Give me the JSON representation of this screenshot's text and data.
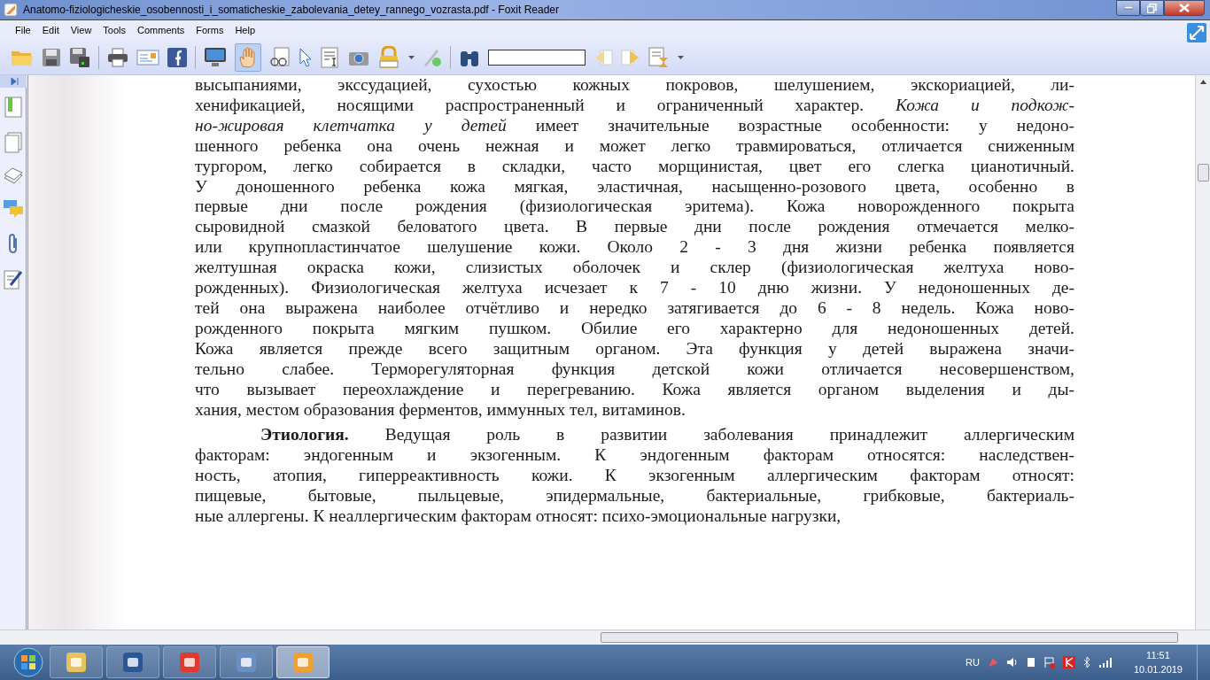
{
  "window": {
    "title": "Anatomo-fiziologicheskie_osobennosti_i_somaticheskie_zabolevania_detey_rannego_vozrasta.pdf - Foxit Reader"
  },
  "menu": [
    "File",
    "Edit",
    "View",
    "Tools",
    "Comments",
    "Forms",
    "Help"
  ],
  "toolbar": {
    "hand_tool": {
      "selected": true
    }
  },
  "document": {
    "paragraphs": [
      {
        "indented": false,
        "lines": [
          "высыпаниями, экссудацией, сухостью кожных покровов, шелушением, экскориацией, ли-",
          "хенификацией, носящими распространенный и ограниченный характер. *Кожа и подкож-*",
          "*но-жировая клетчатка у детей* имеет значительные возрастные особенности: у недоно-",
          "шенного ребенка она очень нежная и может легко травмироваться, отличается сниженным",
          "тургором, легко собирается в складки, часто морщинистая, цвет его слегка цианотичный.",
          "У доношенного ребенка кожа мягкая, эластичная, насыщенно-розового цвета, особенно в",
          "первые дни после рождения (физиологическая эритема). Кожа новорожденного покрыта",
          "сыровидной смазкой беловатого цвета. В первые дни после рождения отмечается мелко-",
          "или крупнопластинчатое шелушение кожи. Около 2 - 3 дня жизни ребенка появляется",
          "желтушная окраска кожи, слизистых оболочек и склер (физиологическая желтуха ново-",
          "рожденных). Физиологическая желтуха исчезает к 7 - 10 дню жизни. У недоношенных де-",
          "тей она выражена наиболее отчётливо и нередко затягивается до 6 - 8 недель. Кожа ново-",
          "рожденного покрыта мягким пушком. Обилие его характерно для недоношенных детей.",
          "Кожа является прежде всего защитным органом. Эта функция у детей выражена значи-",
          "тельно слабее. Терморегуляторная функция детской кожи отличается несовершенством,",
          "что вызывает переохлаждение и перегреванию. Кожа является органом выделения и ды-",
          "хания, местом образования ферментов, иммунных тел, витаминов."
        ]
      },
      {
        "indented": true,
        "lines": [
          "**Этиология.** Ведущая роль в развитии заболевания принадлежит аллергическим",
          "факторам: эндогенным и экзогенным. К эндогенным факторам относятся: наследствен-",
          "ность, атопия, гиперреактивность кожи. К экзогенным аллергическим факторам относят:",
          "пищевые, бытовые, пыльцевые, эпидермальные, бактериальные, грибковые, бактериаль-",
          "ные аллергены. К неаллергическим факторам относят:  психо-эмоциональные нагрузки,"
        ]
      }
    ]
  },
  "taskbar": {
    "apps": [
      {
        "selected": false
      },
      {
        "selected": false
      },
      {
        "selected": false
      },
      {
        "selected": false
      },
      {
        "selected": true
      }
    ],
    "language": "RU",
    "time": "11:51",
    "date": "10.01.2019"
  }
}
